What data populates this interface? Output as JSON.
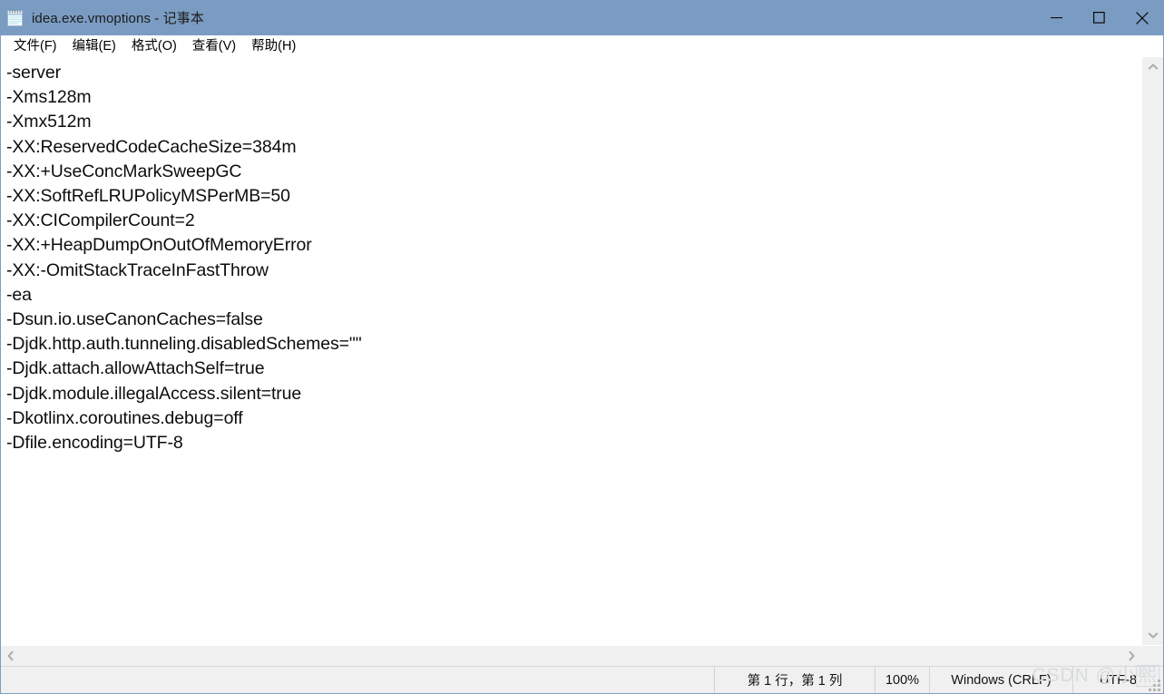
{
  "window": {
    "title": "idea.exe.vmoptions - 记事本",
    "icon": "notepad-icon",
    "titlebar_color": "#7b9cc2",
    "controls": {
      "minimize": "minimize-icon",
      "maximize": "maximize-icon",
      "close": "close-icon"
    }
  },
  "menubar": {
    "items": [
      {
        "label": "文件(F)"
      },
      {
        "label": "编辑(E)"
      },
      {
        "label": "格式(O)"
      },
      {
        "label": "查看(V)"
      },
      {
        "label": "帮助(H)"
      }
    ]
  },
  "editor": {
    "background": "#ffffff",
    "text_color": "#0d0d0d",
    "lines": [
      "-server",
      "-Xms128m",
      "-Xmx512m",
      "-XX:ReservedCodeCacheSize=384m",
      "-XX:+UseConcMarkSweepGC",
      "-XX:SoftRefLRUPolicyMSPerMB=50",
      "-XX:CICompilerCount=2",
      "-XX:+HeapDumpOnOutOfMemoryError",
      "-XX:-OmitStackTraceInFastThrow",
      "-ea",
      "-Dsun.io.useCanonCaches=false",
      "-Djdk.http.auth.tunneling.disabledSchemes=\"\"",
      "-Djdk.attach.allowAttachSelf=true",
      "-Djdk.module.illegalAccess.silent=true",
      "-Dkotlinx.coroutines.debug=off",
      "-Dfile.encoding=UTF-8"
    ]
  },
  "scrollbars": {
    "vertical": {
      "up": "chevron-up-icon",
      "down": "chevron-down-icon"
    },
    "horizontal": {
      "left": "chevron-left-icon",
      "right": "chevron-right-icon"
    }
  },
  "statusbar": {
    "position": "第 1 行，第 1 列",
    "zoom": "100%",
    "line_ending": "Windows (CRLF)",
    "encoding": "UTF-8"
  },
  "watermark": {
    "prefix": "CSDN @小",
    "boxed": "熙"
  }
}
